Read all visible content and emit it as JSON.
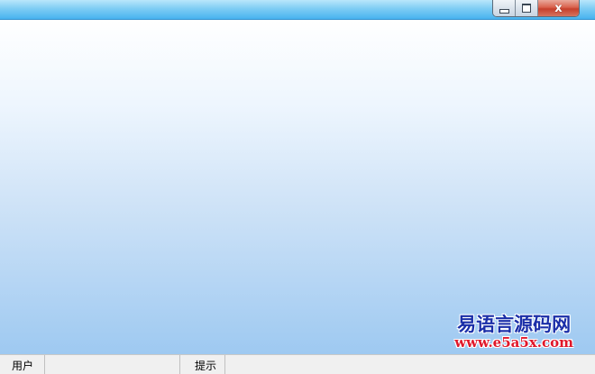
{
  "window": {
    "title": "",
    "buttons": {
      "minimize_icon": "minimize-icon",
      "maximize_icon": "maximize-icon",
      "close_icon": "close-icon",
      "close_glyph": "x"
    }
  },
  "watermark": {
    "title": "易语言源码网",
    "url": "www.e5a5x.com"
  },
  "statusbar": {
    "panes": [
      {
        "label": "用户"
      },
      {
        "label": ""
      },
      {
        "label": "提示"
      },
      {
        "label": ""
      }
    ]
  },
  "colors": {
    "titlebar": "#48b3ef",
    "client_top": "#ffffff",
    "client_bottom": "#9ec9f1",
    "close_button": "#c6402c",
    "watermark_title": "#1a2ea8",
    "watermark_url": "#e0172a"
  }
}
